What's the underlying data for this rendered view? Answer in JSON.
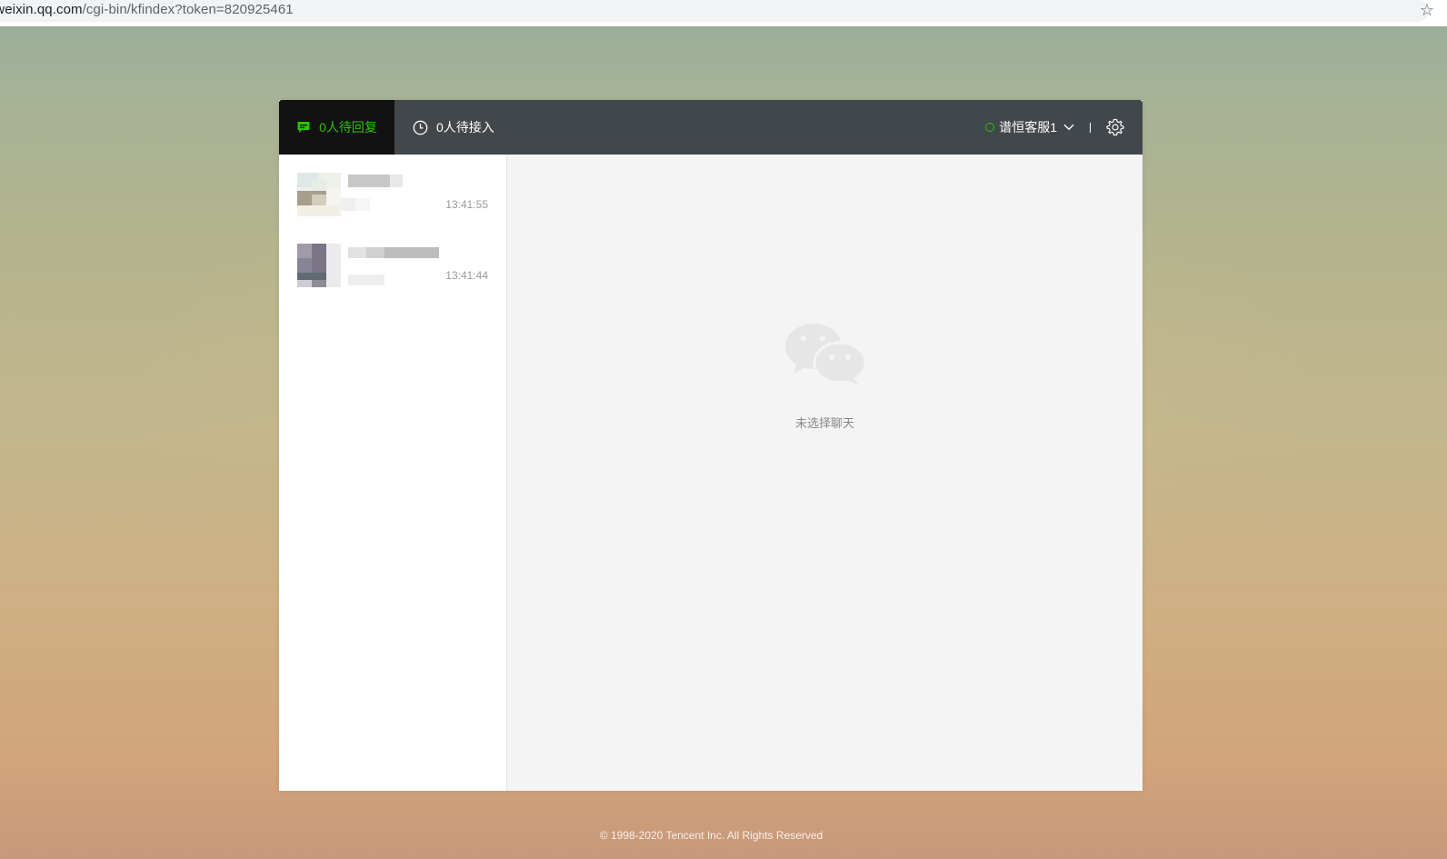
{
  "browser": {
    "url_host": ".weixin.qq.com",
    "url_path": "/cgi-bin/kfindex?token=820925461"
  },
  "header": {
    "tab_reply_label": "0人待回复",
    "tab_waiting_label": "0人待接入",
    "agent_name": "谱恒客服1"
  },
  "conversations": [
    {
      "time": "13:41:55"
    },
    {
      "time": "13:41:44"
    }
  ],
  "chat": {
    "empty_text": "未选择聊天"
  },
  "footer": {
    "copyright": "© 1998-2020 Tencent Inc. All Rights Reserved"
  },
  "colors": {
    "accent_green": "#2dc100",
    "topbar": "#41474a",
    "active_tab": "#121212"
  }
}
